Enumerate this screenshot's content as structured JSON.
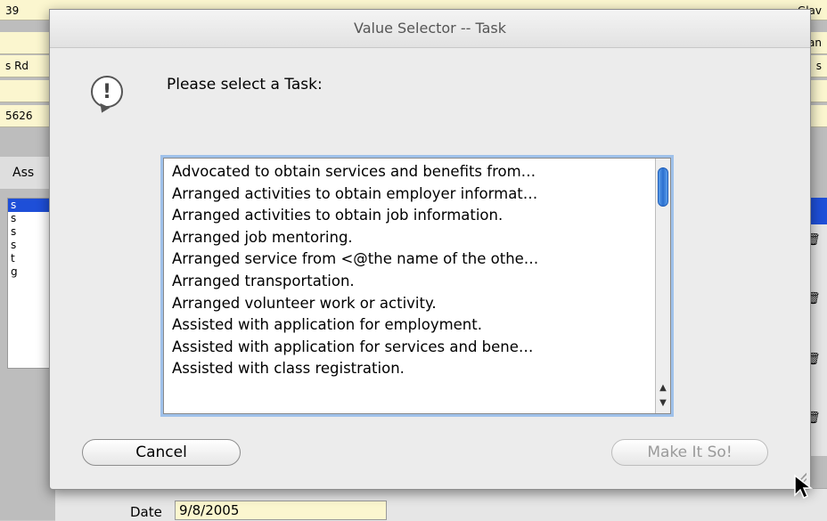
{
  "background": {
    "rows": [
      {
        "left": "39",
        "right": "Glav"
      },
      {
        "left": "",
        "right": "ian"
      },
      {
        "left": "s Rd",
        "right": "s"
      },
      {
        "left": "",
        "right": ""
      },
      {
        "left": "5626",
        "right": ""
      }
    ],
    "tab_label": "Ass",
    "left_list": [
      "s",
      "s",
      "s",
      "s",
      "t",
      "g"
    ],
    "date_label": "Date",
    "date_value": "9/8/2005"
  },
  "dialog": {
    "title": "Value Selector -- Task",
    "prompt": "Please select a Task:",
    "icon": "alert-icon",
    "items": [
      "Advocated to obtain services and benefits from…",
      "Arranged activities to obtain employer informat…",
      "Arranged activities to obtain job information.",
      "Arranged job mentoring.",
      "Arranged service from <@the name of the othe…",
      "Arranged transportation.",
      "Arranged volunteer work or activity.",
      "Assisted with application for employment.",
      "Assisted with application for services and bene…",
      "Assisted with class registration."
    ],
    "cancel_label": "Cancel",
    "ok_label": "Make It So!",
    "accent": "#9fc1ea",
    "selection_color": "#1e4fd8"
  }
}
